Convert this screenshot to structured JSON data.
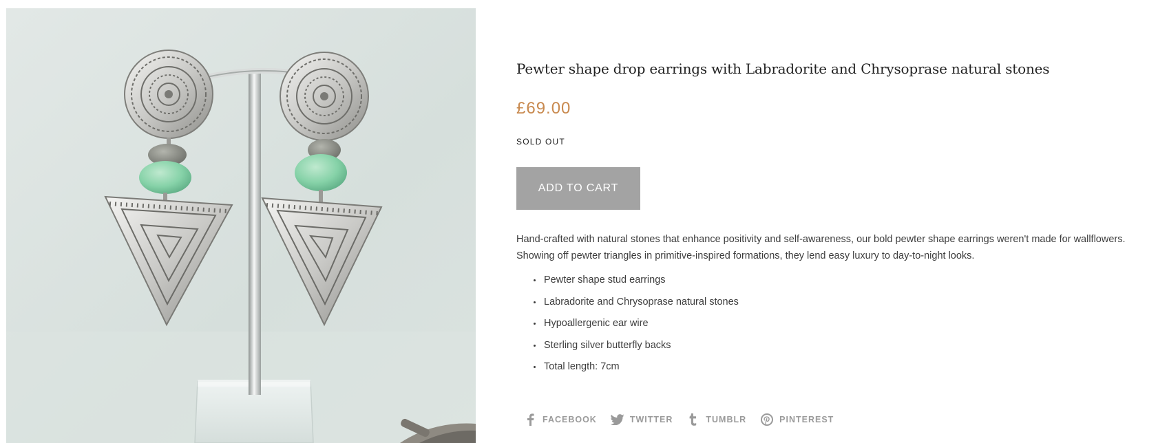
{
  "product": {
    "image_alt": "Pewter shape drop earrings on display stand",
    "title": "Pewter shape drop earrings with Labradorite and Chrysoprase natural stones",
    "price": "£69.00",
    "availability": "SOLD OUT",
    "add_to_cart_label": "ADD TO CART",
    "description": "Hand-crafted with natural stones that enhance positivity and self-awareness, our bold pewter shape earrings weren't made for wallflowers. Showing off pewter triangles in primitive-inspired formations, they lend easy luxury to day-to-night looks.",
    "features": [
      "Pewter shape stud earrings",
      "Labradorite and Chrysoprase natural stones",
      "Hypoallergenic ear wire",
      "Sterling silver butterfly backs",
      "Total length: 7cm"
    ]
  },
  "share": {
    "links": [
      {
        "label": "FACEBOOK",
        "icon": "facebook-icon"
      },
      {
        "label": "TWITTER",
        "icon": "twitter-icon"
      },
      {
        "label": "TUMBLR",
        "icon": "tumblr-icon"
      },
      {
        "label": "PINTEREST",
        "icon": "pinterest-icon"
      }
    ]
  },
  "colors": {
    "price": "#c8894e",
    "button_bg": "#a3a3a3",
    "text": "#3d3d3d",
    "share_text": "#9a9a9a"
  }
}
